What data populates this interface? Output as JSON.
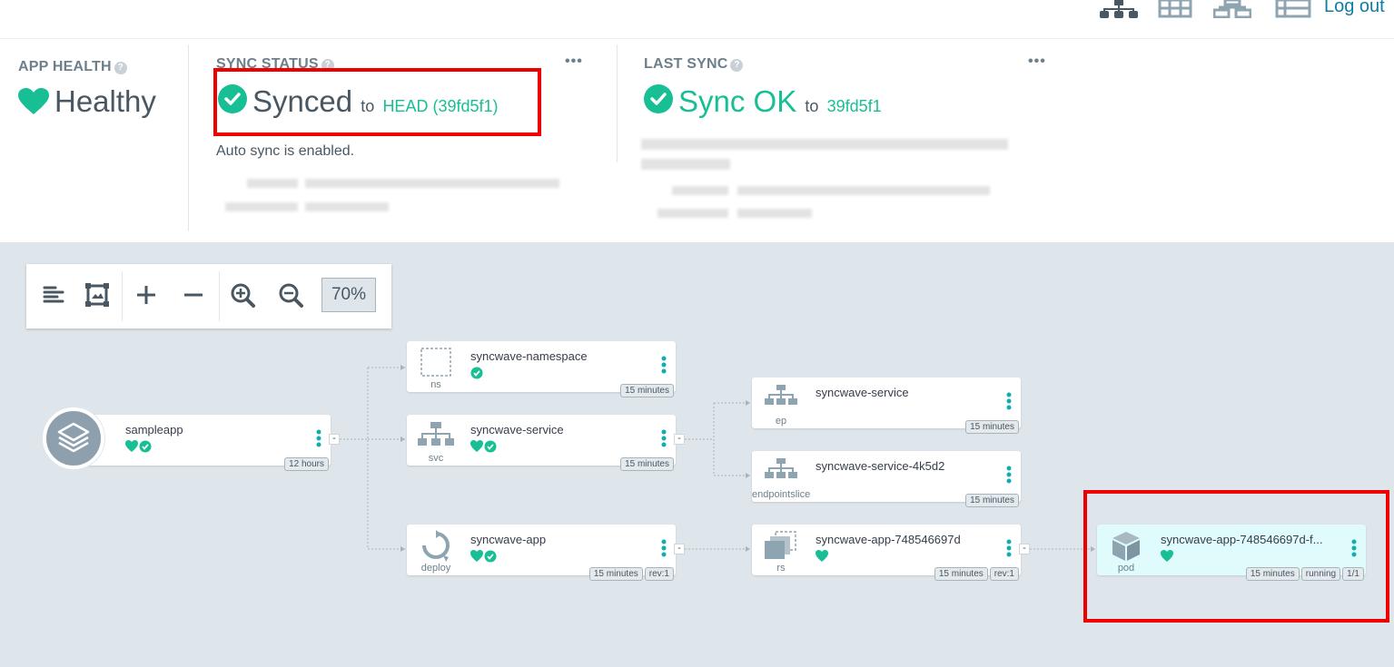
{
  "topbar": {
    "logout_label": "Log out",
    "view_icons": [
      "tree-view-icon",
      "grid-view-icon",
      "network-view-icon",
      "list-view-icon"
    ]
  },
  "app_health": {
    "title": "APP HEALTH",
    "status": "Healthy",
    "icon": "heart-icon",
    "color": "#18be94"
  },
  "sync_status": {
    "title": "SYNC STATUS",
    "status": "Synced",
    "to_label": "to",
    "revision": "HEAD (39fd5f1)",
    "auto_sync": "Auto sync is enabled.",
    "menu": "•••"
  },
  "last_sync": {
    "title": "LAST SYNC",
    "status": "Sync OK",
    "to_label": "to",
    "revision": "39fd5f1",
    "menu": "•••"
  },
  "toolbar": {
    "zoom": "70%",
    "buttons": [
      "align-left-icon",
      "fit-screen-icon",
      "expand-icon",
      "collapse-icon",
      "zoom-in-icon",
      "zoom-out-icon"
    ]
  },
  "nodes": {
    "app": {
      "name": "sampleapp",
      "tags": [
        "12 hours"
      ],
      "icon": "layers-icon"
    },
    "namespace": {
      "name": "syncwave-namespace",
      "kind": "ns",
      "tags": [
        "15 minutes"
      ]
    },
    "service": {
      "name": "syncwave-service",
      "kind": "svc",
      "tags": [
        "15 minutes"
      ]
    },
    "deploy": {
      "name": "syncwave-app",
      "kind": "deploy",
      "tags": [
        "15 minutes",
        "rev:1"
      ]
    },
    "ep": {
      "name": "syncwave-service",
      "kind": "ep",
      "tags": [
        "15 minutes"
      ]
    },
    "epslice": {
      "name": "syncwave-service-4k5d2",
      "kind": "endpointslice",
      "tags": [
        "15 minutes"
      ]
    },
    "rs": {
      "name": "syncwave-app-748546697d",
      "kind": "rs",
      "tags": [
        "15 minutes",
        "rev:1"
      ]
    },
    "pod": {
      "name": "syncwave-app-748546697d-f...",
      "kind": "pod",
      "tags": [
        "15 minutes",
        "running",
        "1/1"
      ]
    }
  },
  "colors": {
    "accent": "#18be94",
    "link": "#0d7ea3",
    "highlight": "#ee0000",
    "graph_bg": "#dee6eb"
  }
}
